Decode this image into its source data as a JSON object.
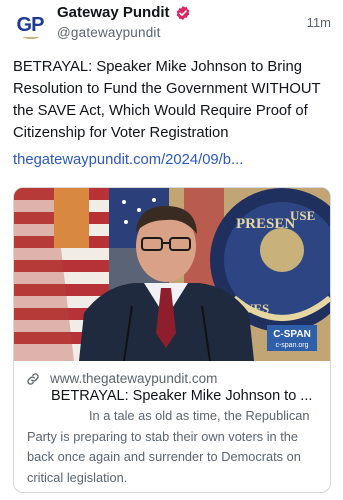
{
  "author": {
    "avatar_text": "GP",
    "display_name": "Gateway Pundit",
    "handle": "@gatewaypundit",
    "verified_color": "#e0245e",
    "time_ago": "11m"
  },
  "post": {
    "text": "BETRAYAL: Speaker Mike Johnson to Bring Resolution to Fund the Government WITHOUT the SAVE Act, Which Would Require Proof of Citizenship for Voter Registration",
    "link_text": "thegatewaypundit.com/2024/09/b..."
  },
  "link_card": {
    "image_icon": "press-conference-photo",
    "watermark_top": "C-SPAN",
    "watermark_bottom": "c-span.org",
    "domain": "www.thegatewaypundit.com",
    "title": "BETRAYAL: Speaker Mike Johnson to ...",
    "description": "In a tale as old as time, the Republican Party is preparing to stab their own voters in the back once again and surrender to Democrats on critical legislation."
  },
  "colors": {
    "link": "#2b58c7",
    "secondary_text": "#5b6570",
    "cspan_badge": "#2f5fa8"
  }
}
